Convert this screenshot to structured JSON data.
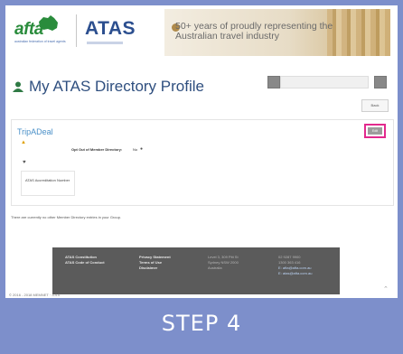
{
  "header": {
    "afta_logo": "afta",
    "afta_tagline": "australian federation of travel agents",
    "atas_logo": "ATAS",
    "banner_text": "50+ years of proudly representing the Australian travel industry"
  },
  "page": {
    "title": "My ATAS Directory Profile",
    "back_label": "Back"
  },
  "profile": {
    "company_name": "TripADeal",
    "edit_label": "Edit",
    "opt_out_label": "Opt Out of Member Directory:",
    "opt_out_value": "No",
    "accreditation_label": "ATAS Accreditation Number"
  },
  "note": "There are currently no other Member Directory entries in your Group.",
  "footer": {
    "col1": [
      "ATAS Constitution",
      "ATAS Code of Conduct"
    ],
    "col2": [
      "Privacy Statement",
      "Terms of Use",
      "Disclaimer"
    ],
    "col3": [
      "Level 3, 309 Pitt St",
      "Sydney NSW 2000",
      "Australia"
    ],
    "col4": [
      "02 9287 9900",
      "1300 363 416"
    ],
    "col4_links": [
      "E: afta@afta.com.au",
      "E: atas@afta.com.au"
    ]
  },
  "copyright": "© 2016 - 2018 MEMNET · 3.4.0",
  "step_label": "STEP 4",
  "colors": {
    "frame": "#7d8fcb",
    "highlight": "#e2298d",
    "title": "#2f4f7f",
    "link": "#4a90c8"
  }
}
